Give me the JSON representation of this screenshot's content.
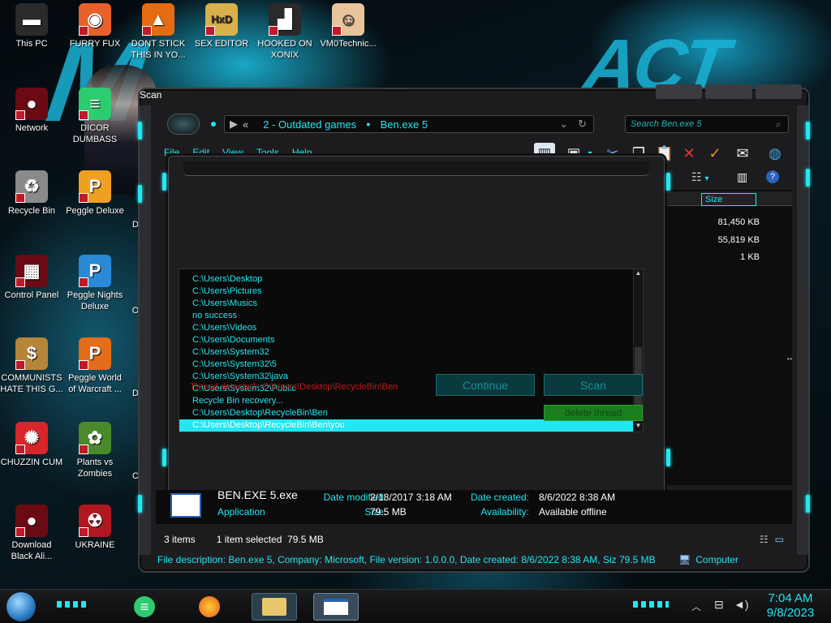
{
  "desktop_icons": [
    {
      "label": "This PC",
      "glyph": "▬",
      "bg": "#2a2a2a"
    },
    {
      "label": "FURRY FUX",
      "glyph": "◉",
      "bg": "#e8612b"
    },
    {
      "label": "DONT STICK THIS IN YO...",
      "glyph": "▲",
      "bg": "#e66b12"
    },
    {
      "label": "SEX EDITOR",
      "glyph": "HxD",
      "bg": "#d9b04a"
    },
    {
      "label": "HOOKED ON XONIX",
      "glyph": "▟",
      "bg": "#2a2a2a"
    },
    {
      "label": "VM0Technic...",
      "glyph": "☺",
      "bg": "#e9c39b"
    },
    {
      "label": "Network",
      "glyph": "●",
      "bg": "#6a0b14"
    },
    {
      "label": "DICOR DUMBASS",
      "glyph": "≡",
      "bg": "#2ecc71"
    },
    {
      "label": "Recycle Bin",
      "glyph": "♻",
      "bg": "#8a8a8a"
    },
    {
      "label": "Peggle Deluxe",
      "glyph": "P",
      "bg": "#f0a020"
    },
    {
      "label": "Control Panel",
      "glyph": "▦",
      "bg": "#6a0b14"
    },
    {
      "label": "Peggle Nights Deluxe",
      "glyph": "P",
      "bg": "#2b8ad6"
    },
    {
      "label": "COMMUNISTS HATE THIS G...",
      "glyph": "$",
      "bg": "#b5853a"
    },
    {
      "label": "Peggle World of Warcraft ...",
      "glyph": "P",
      "bg": "#e46d1a"
    },
    {
      "label": "CHUZZIN CUM",
      "glyph": "✺",
      "bg": "#d7262a"
    },
    {
      "label": "Plants vs Zombies",
      "glyph": "✿",
      "bg": "#4b8a2c"
    },
    {
      "label": "Download Black Ali...",
      "glyph": "●",
      "bg": "#6a0b14"
    },
    {
      "label": "UKRAINE",
      "glyph": "☢",
      "bg": "#b01820"
    }
  ],
  "desktop_partial_labels": [
    "D",
    "O",
    "D",
    "C"
  ],
  "window": {
    "breadcrumb_back": "«",
    "breadcrumb": [
      "2 - Outdated games",
      "Ben.exe 5"
    ],
    "search_placeholder": "Search Ben.exe 5",
    "menu": [
      "File",
      "Edit",
      "View",
      "Tools",
      "Help"
    ],
    "toolbar_icons": [
      "layout-icon",
      "cards-icon",
      "cut-icon",
      "copy-icon",
      "paste-icon",
      "delete-icon",
      "check-icon",
      "email-icon",
      "globe-icon"
    ],
    "column_size": "Size",
    "sizes": [
      "81,450 KB",
      "55,819 KB",
      "1 KB"
    ]
  },
  "dialog": {
    "title": "Scan",
    "log": [
      "C:\\Users\\Desktop",
      "C:\\Users\\Pictures",
      "C:\\Users\\Musics",
      "no success",
      "C:\\Users\\Videos",
      "C:\\Users\\Documents",
      "C:\\Users\\System32",
      "C:\\Users\\System32\\5",
      "C:\\Users\\System32\\java",
      "C:\\Users\\System32\\Public",
      "Recycle Bin recovery...",
      "C:\\Users\\Desktop\\RecycleBin\\Ben",
      "C:\\Users\\Desktop\\RecycleBin\\Ben\\you"
    ],
    "threat_text": "Thread detected : C:\\Users\\Desktop\\RecycleBin\\Ben",
    "continue_label": "Continue",
    "scan_label": "Scan",
    "delete_label": "delete thread"
  },
  "details": {
    "name": "BEN.EXE 5.exe",
    "type": "Application",
    "date_modified_label": "Date modified:",
    "date_modified": "2/18/2017 3:18 AM",
    "size_label": "Size:",
    "size": "79.5 MB",
    "date_created_label": "Date created:",
    "date_created": "8/6/2022 8:38 AM",
    "availability_label": "Availability:",
    "availability": "Available offline"
  },
  "statusbar": {
    "items": "3 items",
    "selected": "1 item selected  79.5 MB",
    "description": "File description: Ben.exe 5, Company: Microsoft, File version: 1.0.0.0, Date created: 8/6/2022 8:38 AM, Siz 79.5 MB",
    "computer": "Computer"
  },
  "taskbar": {
    "time": "7:04 AM",
    "date": "9/8/2023"
  },
  "colors": {
    "accent": "#22e6f0",
    "threat": "#c01616",
    "frame": "#2b2d31"
  }
}
